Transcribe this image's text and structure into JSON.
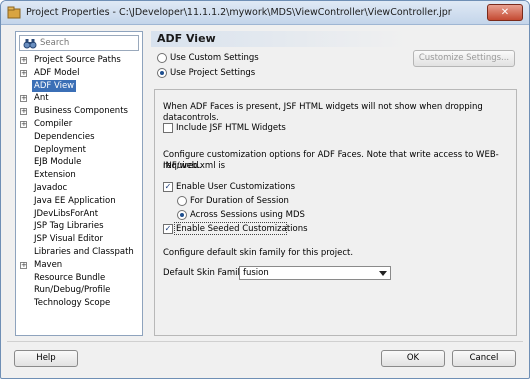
{
  "window": {
    "title": "Project Properties - C:\\JDeveloper\\11.1.1.2\\mywork\\MDS\\ViewController\\ViewController.jpr",
    "close_label": "✕"
  },
  "search": {
    "placeholder": "Search"
  },
  "tree": {
    "items": [
      {
        "label": "Project Source Paths",
        "expandable": true,
        "selected": false
      },
      {
        "label": "ADF Model",
        "expandable": true,
        "selected": false
      },
      {
        "label": "ADF View",
        "expandable": false,
        "selected": true
      },
      {
        "label": "Ant",
        "expandable": true,
        "selected": false
      },
      {
        "label": "Business Components",
        "expandable": true,
        "selected": false
      },
      {
        "label": "Compiler",
        "expandable": true,
        "selected": false
      },
      {
        "label": "Dependencies",
        "expandable": false,
        "selected": false
      },
      {
        "label": "Deployment",
        "expandable": false,
        "selected": false
      },
      {
        "label": "EJB Module",
        "expandable": false,
        "selected": false
      },
      {
        "label": "Extension",
        "expandable": false,
        "selected": false
      },
      {
        "label": "Javadoc",
        "expandable": false,
        "selected": false
      },
      {
        "label": "Java EE Application",
        "expandable": false,
        "selected": false
      },
      {
        "label": "JDevLibsForAnt",
        "expandable": false,
        "selected": false
      },
      {
        "label": "JSP Tag Libraries",
        "expandable": false,
        "selected": false
      },
      {
        "label": "JSP Visual Editor",
        "expandable": false,
        "selected": false
      },
      {
        "label": "Libraries and Classpath",
        "expandable": false,
        "selected": false
      },
      {
        "label": "Maven",
        "expandable": true,
        "selected": false
      },
      {
        "label": "Resource Bundle",
        "expandable": false,
        "selected": false
      },
      {
        "label": "Run/Debug/Profile",
        "expandable": false,
        "selected": false
      },
      {
        "label": "Technology Scope",
        "expandable": false,
        "selected": false
      }
    ]
  },
  "main": {
    "title": "ADF View",
    "use_custom_settings": "Use Custom Settings",
    "use_project_settings": "Use Project Settings",
    "customize_settings_button": "Customize Settings...",
    "jsf_note": "When ADF Faces is present, JSF HTML widgets will not show when dropping datacontrols.",
    "include_jsf_label": "Include JSF HTML Widgets",
    "customization_note_line1": "Configure customization options for ADF Faces. Note that write access to WEB-INF/web.xml is",
    "customization_note_line2": "required.",
    "enable_user_customizations": "Enable User Customizations",
    "for_duration_of_session": "For Duration of Session",
    "across_sessions_using_mds": "Across Sessions using MDS",
    "enable_seeded_customizations": "Enable Seeded Customizations",
    "skin_note": "Configure default skin family for this project.",
    "default_skin_family_label": "Default Skin Family:",
    "default_skin_family_value": "fusion"
  },
  "footer": {
    "help": "Help",
    "ok": "OK",
    "cancel": "Cancel"
  },
  "colors": {
    "selection": "#3b6fb6",
    "title_gradient": "#c4d5ea"
  }
}
